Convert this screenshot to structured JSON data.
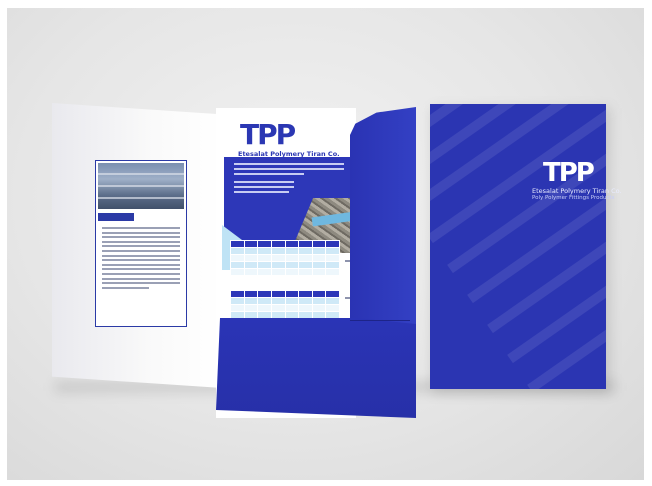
{
  "colors": {
    "brand_blue": "#2b35b2",
    "light_blue": "#bfe3f5",
    "background": "#e6e6e6"
  },
  "brochure": {
    "logo": "TPP",
    "company": "Etesalat Polymery Tiran Co."
  },
  "cover": {
    "logo": "TPP",
    "company": "Etesalat Polymery Tiran Co.",
    "tagline": "Poly Polymer Fittings Products"
  }
}
